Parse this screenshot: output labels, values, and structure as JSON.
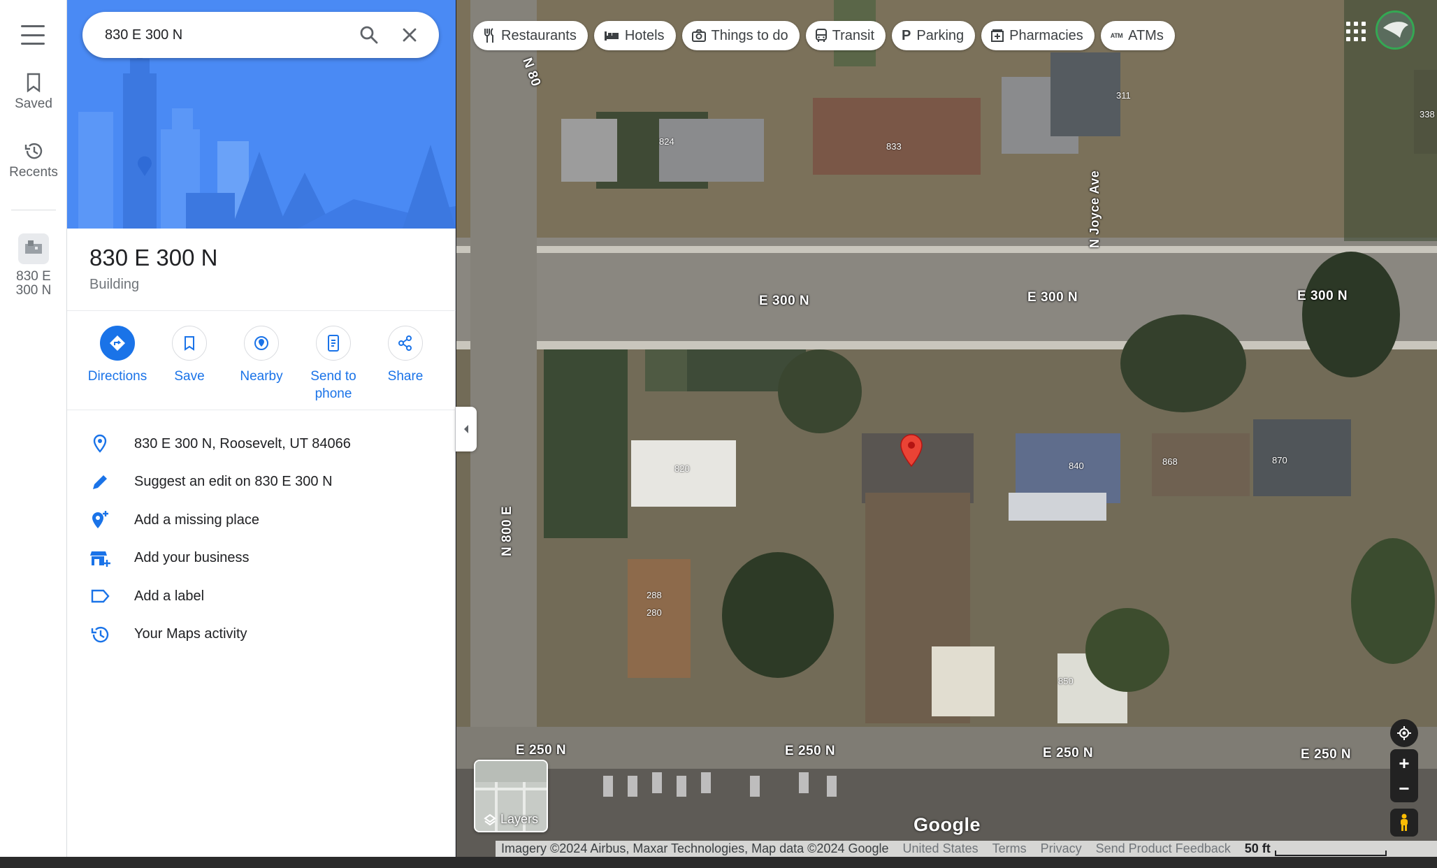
{
  "rail": {
    "saved_label": "Saved",
    "recents_label": "Recents",
    "recent_place_label_1": "830 E",
    "recent_place_label_2": "300 N"
  },
  "search": {
    "value": "830 E 300 N"
  },
  "place": {
    "title": "830 E 300 N",
    "type": "Building"
  },
  "actions": [
    {
      "label": "Directions"
    },
    {
      "label": "Save"
    },
    {
      "label": "Nearby"
    },
    {
      "label": "Send to phone"
    },
    {
      "label": "Share"
    }
  ],
  "info": [
    {
      "text": "830 E 300 N, Roosevelt, UT 84066",
      "icon": "location-pin-icon"
    },
    {
      "text": "Suggest an edit on 830 E 300 N",
      "icon": "pencil-icon"
    },
    {
      "text": "Add a missing place",
      "icon": "add-location-icon"
    },
    {
      "text": "Add your business",
      "icon": "add-business-icon"
    },
    {
      "text": "Add a label",
      "icon": "label-icon"
    },
    {
      "text": "Your Maps activity",
      "icon": "history-icon"
    }
  ],
  "chips": [
    {
      "label": "Restaurants",
      "icon": "fork-knife-icon"
    },
    {
      "label": "Hotels",
      "icon": "bed-icon"
    },
    {
      "label": "Things to do",
      "icon": "camera-icon"
    },
    {
      "label": "Transit",
      "icon": "bus-icon"
    },
    {
      "label": "Parking",
      "icon": "parking-icon"
    },
    {
      "label": "Pharmacies",
      "icon": "pharmacy-icon"
    },
    {
      "label": "ATMs",
      "icon": "atm-icon"
    }
  ],
  "map": {
    "roads": {
      "e300_a": "E 300 N",
      "e300_b": "E 300 N",
      "e300_c": "E 300 N",
      "e250_a": "E 250 N",
      "e250_b": "E 250 N",
      "e250_c": "E 250 N",
      "e250_d": "E 250 N",
      "n800_top": "N 80",
      "n800": "N 800 E",
      "joyce": "N Joyce Ave"
    },
    "house_numbers": {
      "h824": "824",
      "h833": "833",
      "h311": "311",
      "h338": "338",
      "h820": "820",
      "h840": "840",
      "h868": "868",
      "h870": "870",
      "h288": "288",
      "h280": "280",
      "h850": "850"
    },
    "layers_label": "Layers",
    "logo": "Google"
  },
  "footer": {
    "imagery": "Imagery ©2024 Airbus, Maxar Technologies, Map data ©2024 Google",
    "country": "United States",
    "terms": "Terms",
    "privacy": "Privacy",
    "feedback": "Send Product Feedback",
    "scale": "50 ft"
  },
  "colors": {
    "accent": "#1a73e8",
    "pin": "#ea4335",
    "hero": "#4a8af4"
  }
}
